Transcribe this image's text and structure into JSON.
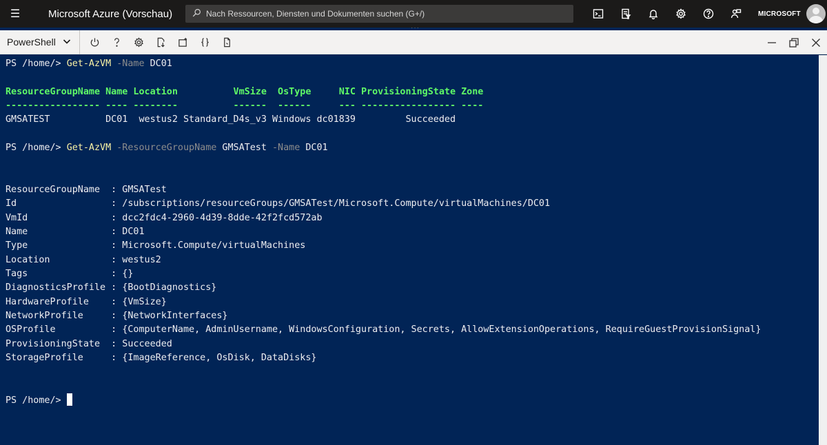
{
  "topbar": {
    "menu_icon": "hamburger-icon",
    "title": "Microsoft Azure (Vorschau)",
    "search_placeholder": "Nach Ressourcen, Diensten und Dokumenten suchen (G+/)",
    "icons": [
      "cloud-shell-icon",
      "directory-filter-icon",
      "notifications-bell-icon",
      "settings-gear-icon",
      "help-icon",
      "feedback-icon"
    ],
    "account_name": "MICROSOFT"
  },
  "toolbar": {
    "shell": "PowerShell",
    "icons": [
      "power-restart-icon",
      "help-icon",
      "settings-gear-icon",
      "upload-download-icon",
      "new-session-icon",
      "braces-editor-icon",
      "web-preview-icon"
    ],
    "window_icons": [
      "minimize-icon",
      "restore-icon",
      "close-icon"
    ]
  },
  "terminal": {
    "prompt": "PS /home/> ",
    "cmd1": {
      "name": "Get-AzVM",
      "p1": " -Name",
      "v1": " DC01"
    },
    "table_header": "ResourceGroupName Name Location          VmSize  OsType     NIC ProvisioningState Zone",
    "table_rule": "----------------- ---- --------          ------  ------     --- ----------------- ----",
    "table_row": "GMSATEST          DC01  westus2 Standard_D4s_v3 Windows dc01839         Succeeded",
    "cmd2": {
      "name": "Get-AzVM",
      "p1": " -ResourceGroupName",
      "v1": " GMSATest",
      "p2": " -Name",
      "v2": " DC01"
    },
    "props": [
      "ResourceGroupName  : GMSATest",
      "Id                 : /subscriptions/resourceGroups/GMSATest/Microsoft.Compute/virtualMachines/DC01",
      "VmId               : dcc2fdc4-2960-4d39-8dde-42f2fcd572ab",
      "Name               : DC01",
      "Type               : Microsoft.Compute/virtualMachines",
      "Location           : westus2",
      "Tags               : {}",
      "DiagnosticsProfile : {BootDiagnostics}",
      "HardwareProfile    : {VmSize}",
      "NetworkProfile     : {NetworkInterfaces}",
      "OSProfile          : {ComputerName, AdminUsername, WindowsConfiguration, Secrets, AllowExtensionOperations, RequireGuestProvisionSignal}",
      "ProvisioningState  : Succeeded",
      "StorageProfile     : {ImageReference, OsDisk, DataDisks}"
    ]
  },
  "colors": {
    "terminal_bg": "#012456",
    "command": "#f9f1a5",
    "parameter": "#8c8c8c",
    "header": "#5ff967",
    "topbar_bg": "#1b1a19"
  }
}
